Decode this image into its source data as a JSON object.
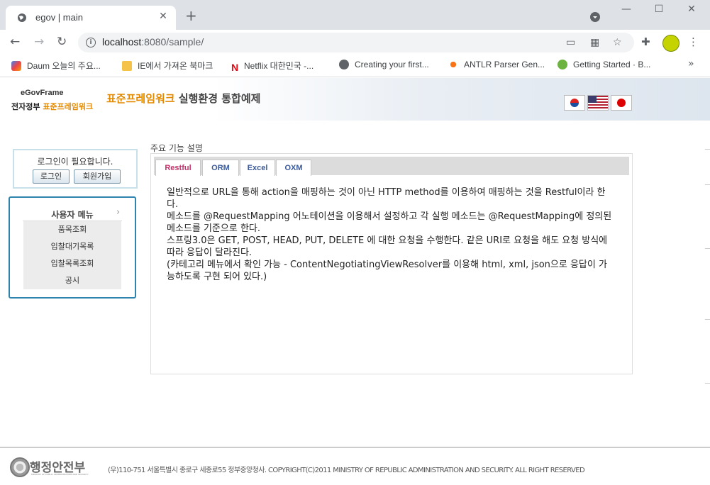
{
  "browser": {
    "tab_title": "egov | main",
    "tab_close": "✕",
    "new_tab": "+",
    "url_host": "localhost",
    "url_rest": ":8080/sample/",
    "window": {
      "minimize": "—",
      "maximize": "☐",
      "close": "✕"
    },
    "bookmarks": [
      {
        "label": "Daum 오늘의 주요...",
        "icon": "daum-icon"
      },
      {
        "label": "IE에서 가져온 북마크",
        "icon": "folder-icon"
      },
      {
        "label": "Netflix 대한민국 -...",
        "icon": "netflix-icon"
      },
      {
        "label": "Creating your first...",
        "icon": "globe-icon"
      },
      {
        "label": "ANTLR Parser Gen...",
        "icon": "antlr-icon"
      },
      {
        "label": "Getting Started · B...",
        "icon": "spring-icon"
      }
    ],
    "bookmarks_more": "»"
  },
  "header": {
    "logo_line1": "eGovFrame",
    "logo_line2_a": "전자정부 ",
    "logo_line2_b": "표준프레임워크",
    "title_highlight": "표준프레임워크",
    "title_rest": " 실행환경 통합예제"
  },
  "login": {
    "message": "로그인이 필요합니다.",
    "login_button": "로그인",
    "signup_button": "회원가입"
  },
  "user_menu": {
    "title": "사용자 메뉴",
    "arrow": "›",
    "items": [
      "품목조회",
      "입찰대기목록",
      "입찰목록조회",
      "공시"
    ]
  },
  "main": {
    "section_label": "주요 기능 설명",
    "tabs": [
      "Restful",
      "ORM",
      "Excel",
      "OXM"
    ],
    "paragraphs": [
      "일반적으로 URL을 통해 action을 매핑하는 것이 아닌 HTTP method를 이용하여 매핑하는 것을 Restful이라 한다.",
      "메소드를 @RequestMapping 어노테이션을 이용해서 설정하고 각 실행 메소드는 @RequestMapping에 정의된 메소드를 기준으로 한다.",
      "스프링3.0은 GET, POST, HEAD, PUT, DELETE 에 대한 요청을 수행한다. 같은 URI로 요청을 해도 요청 방식에 따라 응답이 달라진다.",
      "(카테고리 메뉴에서 확인 가능 - ContentNegotiatingViewResolver를 이용해 html, xml, json으로 응답이 가능하도록 구현 되어 있다.)"
    ]
  },
  "footer": {
    "logo_text": "행정안전부",
    "logo_sub": "MINISTRY OF PUBLIC ADMINISTRATION AND SECURITY",
    "copyright": "(우)110-751 서울특별시 종로구 세종로55 정부중앙청사. COPYRIGHT(C)2011 MINISTRY OF REPUBLIC ADMINISTRATION AND SECURITY. ALL RIGHT RESERVED"
  }
}
